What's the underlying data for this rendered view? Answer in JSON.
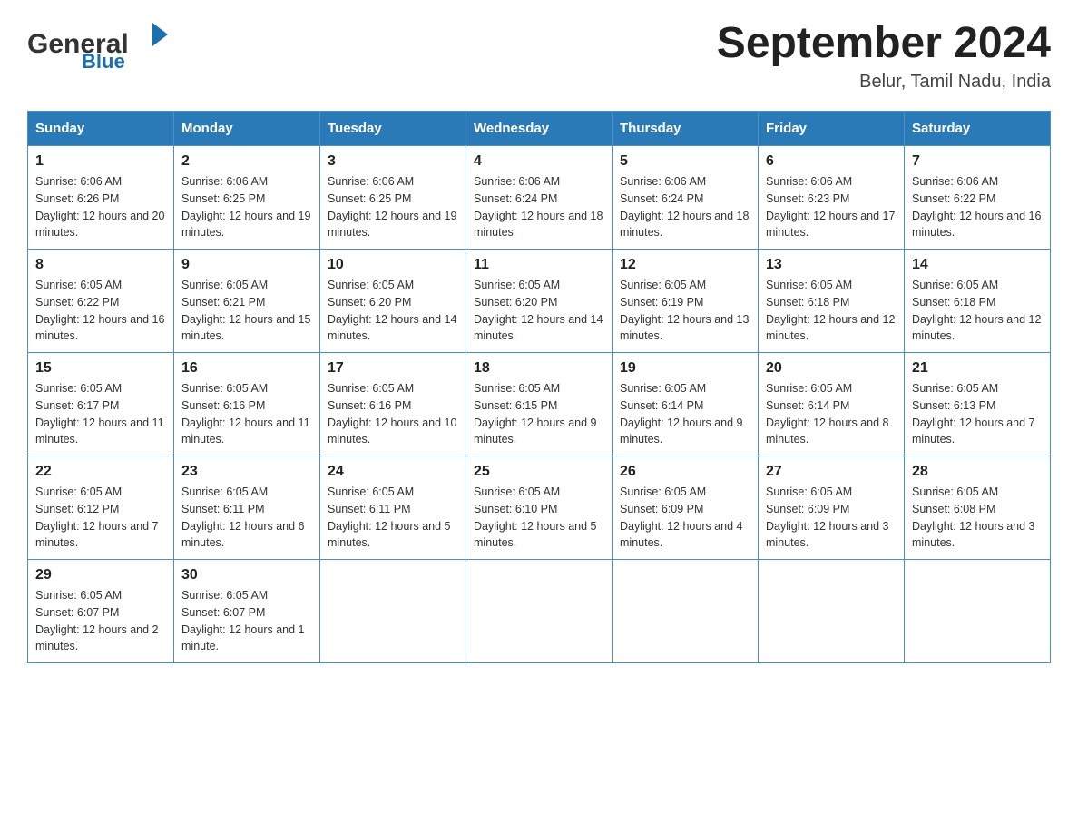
{
  "header": {
    "logo_general": "General",
    "logo_blue": "Blue",
    "month_year": "September 2024",
    "location": "Belur, Tamil Nadu, India"
  },
  "days_of_week": [
    "Sunday",
    "Monday",
    "Tuesday",
    "Wednesday",
    "Thursday",
    "Friday",
    "Saturday"
  ],
  "weeks": [
    [
      {
        "day": "1",
        "sunrise": "Sunrise: 6:06 AM",
        "sunset": "Sunset: 6:26 PM",
        "daylight": "Daylight: 12 hours and 20 minutes."
      },
      {
        "day": "2",
        "sunrise": "Sunrise: 6:06 AM",
        "sunset": "Sunset: 6:25 PM",
        "daylight": "Daylight: 12 hours and 19 minutes."
      },
      {
        "day": "3",
        "sunrise": "Sunrise: 6:06 AM",
        "sunset": "Sunset: 6:25 PM",
        "daylight": "Daylight: 12 hours and 19 minutes."
      },
      {
        "day": "4",
        "sunrise": "Sunrise: 6:06 AM",
        "sunset": "Sunset: 6:24 PM",
        "daylight": "Daylight: 12 hours and 18 minutes."
      },
      {
        "day": "5",
        "sunrise": "Sunrise: 6:06 AM",
        "sunset": "Sunset: 6:24 PM",
        "daylight": "Daylight: 12 hours and 18 minutes."
      },
      {
        "day": "6",
        "sunrise": "Sunrise: 6:06 AM",
        "sunset": "Sunset: 6:23 PM",
        "daylight": "Daylight: 12 hours and 17 minutes."
      },
      {
        "day": "7",
        "sunrise": "Sunrise: 6:06 AM",
        "sunset": "Sunset: 6:22 PM",
        "daylight": "Daylight: 12 hours and 16 minutes."
      }
    ],
    [
      {
        "day": "8",
        "sunrise": "Sunrise: 6:05 AM",
        "sunset": "Sunset: 6:22 PM",
        "daylight": "Daylight: 12 hours and 16 minutes."
      },
      {
        "day": "9",
        "sunrise": "Sunrise: 6:05 AM",
        "sunset": "Sunset: 6:21 PM",
        "daylight": "Daylight: 12 hours and 15 minutes."
      },
      {
        "day": "10",
        "sunrise": "Sunrise: 6:05 AM",
        "sunset": "Sunset: 6:20 PM",
        "daylight": "Daylight: 12 hours and 14 minutes."
      },
      {
        "day": "11",
        "sunrise": "Sunrise: 6:05 AM",
        "sunset": "Sunset: 6:20 PM",
        "daylight": "Daylight: 12 hours and 14 minutes."
      },
      {
        "day": "12",
        "sunrise": "Sunrise: 6:05 AM",
        "sunset": "Sunset: 6:19 PM",
        "daylight": "Daylight: 12 hours and 13 minutes."
      },
      {
        "day": "13",
        "sunrise": "Sunrise: 6:05 AM",
        "sunset": "Sunset: 6:18 PM",
        "daylight": "Daylight: 12 hours and 12 minutes."
      },
      {
        "day": "14",
        "sunrise": "Sunrise: 6:05 AM",
        "sunset": "Sunset: 6:18 PM",
        "daylight": "Daylight: 12 hours and 12 minutes."
      }
    ],
    [
      {
        "day": "15",
        "sunrise": "Sunrise: 6:05 AM",
        "sunset": "Sunset: 6:17 PM",
        "daylight": "Daylight: 12 hours and 11 minutes."
      },
      {
        "day": "16",
        "sunrise": "Sunrise: 6:05 AM",
        "sunset": "Sunset: 6:16 PM",
        "daylight": "Daylight: 12 hours and 11 minutes."
      },
      {
        "day": "17",
        "sunrise": "Sunrise: 6:05 AM",
        "sunset": "Sunset: 6:16 PM",
        "daylight": "Daylight: 12 hours and 10 minutes."
      },
      {
        "day": "18",
        "sunrise": "Sunrise: 6:05 AM",
        "sunset": "Sunset: 6:15 PM",
        "daylight": "Daylight: 12 hours and 9 minutes."
      },
      {
        "day": "19",
        "sunrise": "Sunrise: 6:05 AM",
        "sunset": "Sunset: 6:14 PM",
        "daylight": "Daylight: 12 hours and 9 minutes."
      },
      {
        "day": "20",
        "sunrise": "Sunrise: 6:05 AM",
        "sunset": "Sunset: 6:14 PM",
        "daylight": "Daylight: 12 hours and 8 minutes."
      },
      {
        "day": "21",
        "sunrise": "Sunrise: 6:05 AM",
        "sunset": "Sunset: 6:13 PM",
        "daylight": "Daylight: 12 hours and 7 minutes."
      }
    ],
    [
      {
        "day": "22",
        "sunrise": "Sunrise: 6:05 AM",
        "sunset": "Sunset: 6:12 PM",
        "daylight": "Daylight: 12 hours and 7 minutes."
      },
      {
        "day": "23",
        "sunrise": "Sunrise: 6:05 AM",
        "sunset": "Sunset: 6:11 PM",
        "daylight": "Daylight: 12 hours and 6 minutes."
      },
      {
        "day": "24",
        "sunrise": "Sunrise: 6:05 AM",
        "sunset": "Sunset: 6:11 PM",
        "daylight": "Daylight: 12 hours and 5 minutes."
      },
      {
        "day": "25",
        "sunrise": "Sunrise: 6:05 AM",
        "sunset": "Sunset: 6:10 PM",
        "daylight": "Daylight: 12 hours and 5 minutes."
      },
      {
        "day": "26",
        "sunrise": "Sunrise: 6:05 AM",
        "sunset": "Sunset: 6:09 PM",
        "daylight": "Daylight: 12 hours and 4 minutes."
      },
      {
        "day": "27",
        "sunrise": "Sunrise: 6:05 AM",
        "sunset": "Sunset: 6:09 PM",
        "daylight": "Daylight: 12 hours and 3 minutes."
      },
      {
        "day": "28",
        "sunrise": "Sunrise: 6:05 AM",
        "sunset": "Sunset: 6:08 PM",
        "daylight": "Daylight: 12 hours and 3 minutes."
      }
    ],
    [
      {
        "day": "29",
        "sunrise": "Sunrise: 6:05 AM",
        "sunset": "Sunset: 6:07 PM",
        "daylight": "Daylight: 12 hours and 2 minutes."
      },
      {
        "day": "30",
        "sunrise": "Sunrise: 6:05 AM",
        "sunset": "Sunset: 6:07 PM",
        "daylight": "Daylight: 12 hours and 1 minute."
      },
      null,
      null,
      null,
      null,
      null
    ]
  ]
}
